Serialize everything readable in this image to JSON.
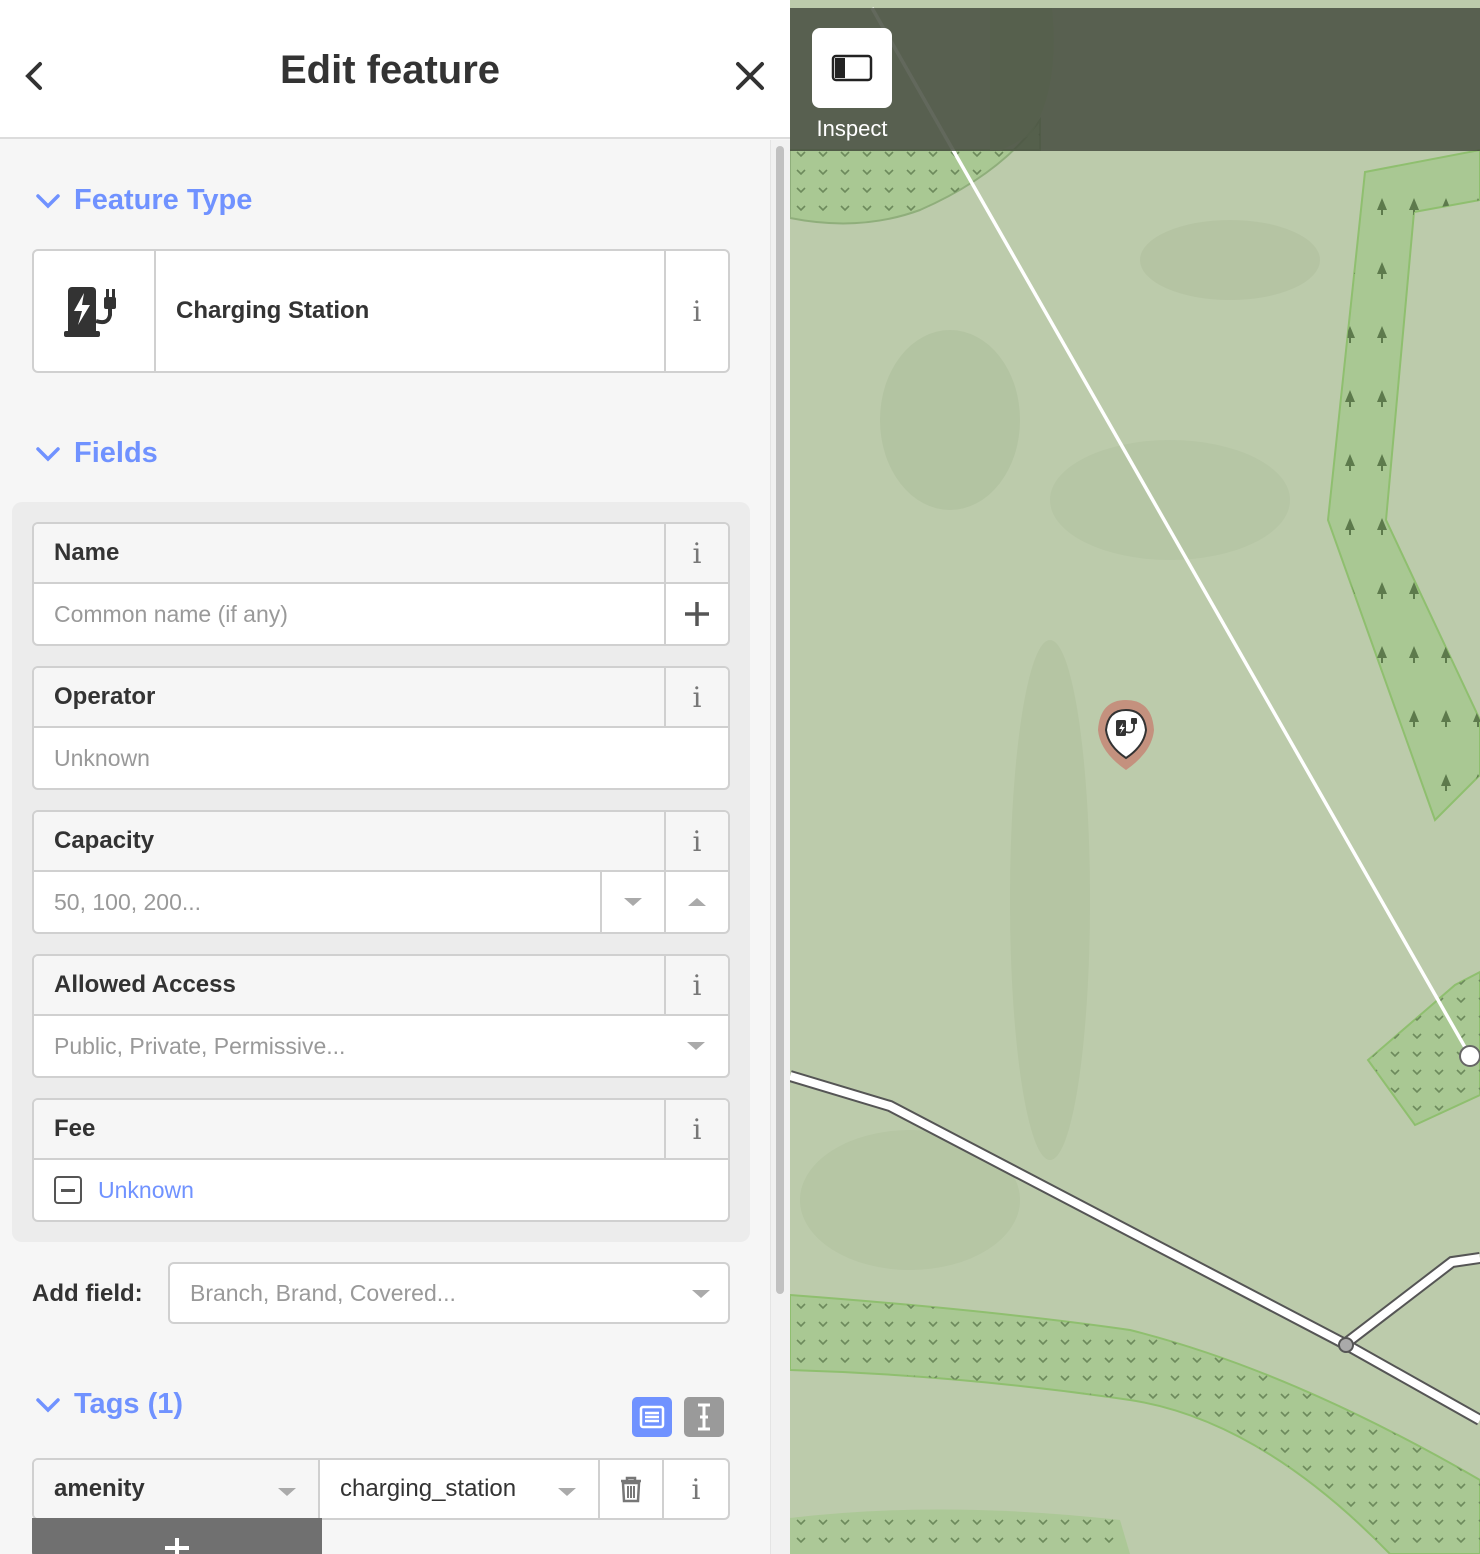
{
  "header": {
    "title": "Edit feature"
  },
  "sections": {
    "feature_type": "Feature Type",
    "fields": "Fields",
    "tags": "Tags (1)"
  },
  "preset": {
    "name": "Charging Station",
    "icon": "charging-station-icon"
  },
  "fields": {
    "name": {
      "label": "Name",
      "placeholder": "Common name (if any)"
    },
    "operator": {
      "label": "Operator",
      "placeholder": "Unknown"
    },
    "capacity": {
      "label": "Capacity",
      "placeholder": "50, 100, 200..."
    },
    "access": {
      "label": "Allowed Access",
      "placeholder": "Public, Private, Permissive..."
    },
    "fee": {
      "label": "Fee",
      "value": "Unknown"
    }
  },
  "add_field": {
    "label": "Add field:",
    "placeholder": "Branch, Brand, Covered..."
  },
  "tags": [
    {
      "key": "amenity",
      "value": "charging_station"
    }
  ],
  "map": {
    "inspect_label": "Inspect"
  },
  "colors": {
    "accent": "#7092ff",
    "map_bg": "#b9c9a7",
    "forest": "#a9c893"
  }
}
